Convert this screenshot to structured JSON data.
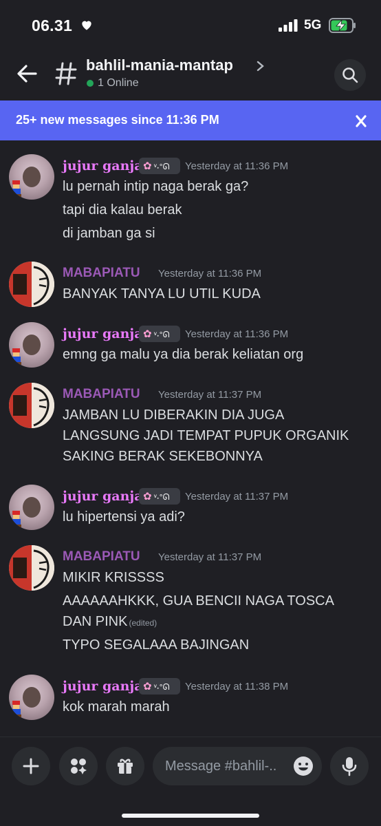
{
  "status_bar": {
    "time": "06.31",
    "network": "5G"
  },
  "header": {
    "channel_name": "bahlil-mania-mantap",
    "online_text": "1 Online"
  },
  "banner": {
    "text": "25+ new messages since 11:36 PM"
  },
  "messages": [
    {
      "author": "jujur ganjar",
      "time": "Yesterday at 11:36 PM",
      "tag": "ᵛ˖°ᘏ",
      "lines": [
        "lu pernah intip naga berak ga?",
        "tapi dia kalau berak",
        "di jamban ga si"
      ]
    },
    {
      "author": "MABAPIATU",
      "time": "Yesterday at 11:36 PM",
      "lines": [
        "BANYAK TANYA LU UTIL KUDA"
      ]
    },
    {
      "author": "jujur ganjar",
      "time": "Yesterday at 11:36 PM",
      "tag": "ᵛ˖°ᘏ",
      "lines": [
        "emng ga malu ya dia berak keliatan org"
      ]
    },
    {
      "author": "MABAPIATU",
      "time": "Yesterday at 11:37 PM",
      "lines": [
        "JAMBAN LU DIBERAKIN DIA JUGA",
        "LANGSUNG JADI TEMPAT PUPUK ORGANIK",
        "SAKING BERAK SEKEBONNYA"
      ]
    },
    {
      "author": "jujur ganjar",
      "time": "Yesterday at 11:37 PM",
      "tag": "ᵛ˖°ᘏ",
      "lines": [
        "lu hipertensi ya adi?"
      ]
    },
    {
      "author": "MABAPIATU",
      "time": "Yesterday at 11:37 PM",
      "lines": [
        "MIKIR KRISSSS",
        "AAAAAAHKKK, GUA BENCII NAGA TOSCA",
        "DAN PINK",
        "TYPO SEGALAAA BAJINGAN"
      ],
      "edited": "(edited)"
    },
    {
      "author": "jujur ganjar",
      "time": "Yesterday at 11:38 PM",
      "tag": "ᵛ˖°ᘏ",
      "lines": [
        "kok marah marah"
      ]
    }
  ],
  "composer": {
    "placeholder": "Message #bahlil-.."
  },
  "colors": {
    "accent": "#5865f2",
    "ganjar_name": "#e879f9",
    "mabapiatu_name": "#9b59b6",
    "online": "#23a559"
  }
}
